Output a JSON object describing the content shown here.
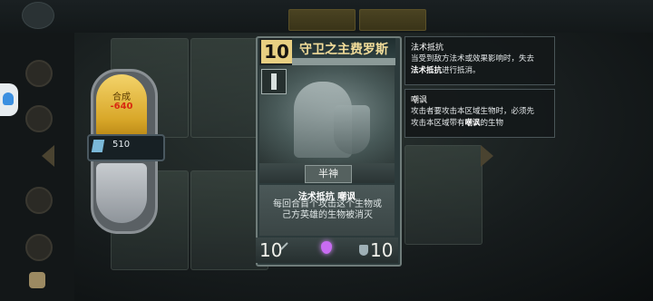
{
  "craft": {
    "label": "合成",
    "cost": "-640"
  },
  "dust": {
    "value": "510"
  },
  "card": {
    "cost": "10",
    "name": "守卫之主费罗斯",
    "tribe": "半神",
    "keywords": "法术抵抗 嘲讽",
    "desc_line1": "每回合首个攻击这个生物或",
    "desc_line2": "己方英雄的生物被消灭",
    "attack": "10",
    "health": "10"
  },
  "tooltips": [
    {
      "title": "法术抵抗",
      "line1": "当受到敌方法术或效果影响时，失去",
      "line2_bold": "法术抵抗",
      "line2_rest": "进行抵消。"
    },
    {
      "title": "嘲讽",
      "line1": "攻击者要攻击本区域生物时，必须先",
      "line2_pre": "攻击本区域带有",
      "line2_bold": "嘲讽",
      "line2_rest": "的生物"
    }
  ],
  "colors": {
    "gold": "#e8cf82",
    "cost_red": "#d82a10",
    "gem": "#c86cf2"
  },
  "icons": [
    "home-icon",
    "profile-icon",
    "friends-icon",
    "dust-icon",
    "sword-icon",
    "shield-icon",
    "gem-icon",
    "type-icon"
  ]
}
